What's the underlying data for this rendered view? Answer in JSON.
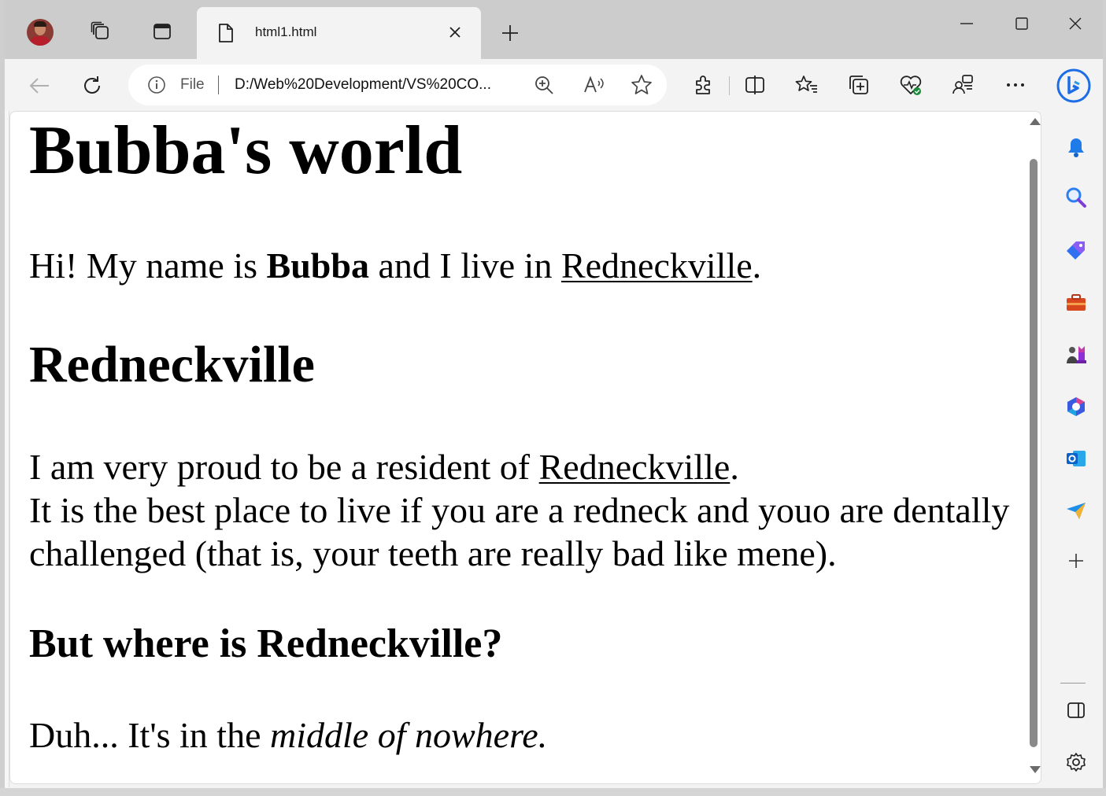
{
  "browser": {
    "tab_title": "html1.html",
    "address": {
      "scheme_label": "File",
      "url": "D:/Web%20Development/VS%20CO..."
    }
  },
  "page": {
    "heading1": "Bubba's world",
    "intro": {
      "before": "Hi! My name is ",
      "bold": "Bubba",
      "middle": " and I live in ",
      "link": "Redneckville",
      "after": "."
    },
    "heading2": "Redneckville",
    "para2": {
      "line1_before": "I am very proud to be a resident of ",
      "line1_link": "Redneckville",
      "line1_after": ".",
      "line2": "It is the best place to live if you are a redneck and youo are dentally challenged (that is, your teeth are really bad like mene)."
    },
    "heading3": "But where is Redneckville?",
    "para3": {
      "before": "Duh... It's in the ",
      "italic": "middle of nowhere."
    }
  },
  "icons": {
    "tabstrip": [
      "profile-avatar",
      "workspaces-icon",
      "tab-actions-icon",
      "page-icon",
      "close-icon",
      "new-tab-icon"
    ],
    "window_controls": [
      "minimize-icon",
      "maximize-icon",
      "close-window-icon"
    ],
    "toolbar": [
      "back-icon",
      "refresh-icon",
      "info-icon",
      "zoom-icon",
      "read-aloud-icon",
      "favorite-star-icon",
      "extensions-icon",
      "split-screen-icon",
      "favorites-icon",
      "collections-icon",
      "browser-essentials-icon",
      "profile-switch-icon",
      "more-icon",
      "bing-icon"
    ],
    "sidebar": [
      "notification-bell-icon",
      "search-icon",
      "shopping-tag-icon",
      "tools-icon",
      "games-icon",
      "microsoft-365-icon",
      "outlook-icon",
      "send-icon",
      "add-icon",
      "sidebar-toggle-icon",
      "settings-icon"
    ]
  },
  "colors": {
    "tabstrip": "#cccccc",
    "toolbar": "#f3f3f3",
    "page_bg": "#ffffff",
    "bing_blue": "#1d6ee6"
  }
}
